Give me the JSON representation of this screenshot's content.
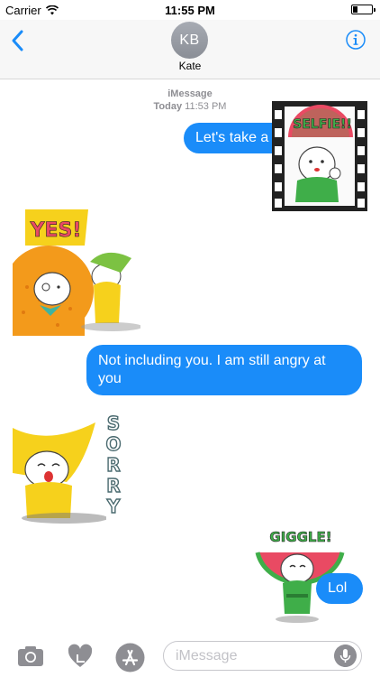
{
  "status": {
    "carrier": "Carrier",
    "time": "11:55 PM",
    "battery_level": 0.25
  },
  "nav": {
    "avatar_initials": "KB",
    "contact_name": "Kate"
  },
  "meta": {
    "service": "iMessage",
    "day": "Today",
    "time": "11:53 PM"
  },
  "messages": [
    {
      "from": "me",
      "text": "Let's take a"
    },
    {
      "from": "sticker",
      "caption": "SELFIE!!"
    },
    {
      "from": "sticker",
      "caption": "YES!"
    },
    {
      "from": "me",
      "text": "Not including you. I am still angry at you"
    },
    {
      "from": "sticker",
      "caption": "SORRY"
    },
    {
      "from": "sticker",
      "caption": "GIGGLE!"
    },
    {
      "from": "me",
      "text": "Lol"
    }
  ],
  "composer": {
    "placeholder": "iMessage"
  },
  "colors": {
    "bubble": "#1a8cf9",
    "accent": "#1a8cf9",
    "muted": "#8e8e93"
  }
}
